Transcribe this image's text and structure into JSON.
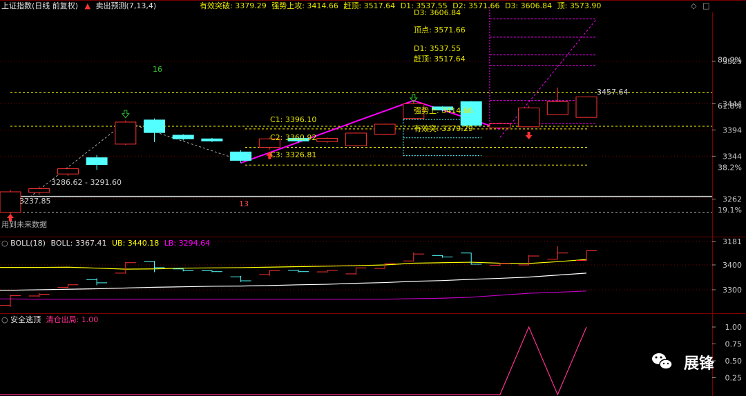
{
  "header": {
    "title": "上证指数(日线 前复权)",
    "indicator": "卖出预测(7,13,4)",
    "items": [
      {
        "label": "有效突破",
        "value": "3379.29"
      },
      {
        "label": "强势上攻",
        "value": "3414.66"
      },
      {
        "label": "赶顶",
        "value": "3517.64"
      },
      {
        "label": "D1",
        "value": "3537.55"
      },
      {
        "label": "D2",
        "value": "3571.66"
      },
      {
        "label": "D3",
        "value": "3606.84"
      },
      {
        "label": "顶",
        "value": "3573.90"
      }
    ],
    "top_right_icons": [
      "diamond-icon",
      "square-icon"
    ]
  },
  "colors": {
    "up": "#ff3232",
    "down": "#54ffff",
    "grid": "#7a0000",
    "yellow": "#ffff00",
    "magenta": "#ff00ff",
    "white": "#ffffff",
    "boll_lb": "#c000c0",
    "text": "#c8c8c8",
    "label_yellow": "#e6e600"
  },
  "chart_data": [
    {
      "type": "candlestick",
      "title": "上证指数(日线 前复权)",
      "y_ticks": [
        "3525",
        "3444",
        "3394",
        "3344",
        "3262",
        "3181"
      ],
      "pct_ticks": [
        "80.9%",
        "61.8%",
        "38.2%",
        "19.1%"
      ],
      "ylim": [
        3150,
        3610
      ],
      "candles": [
        {
          "o": 3237,
          "h": 3280,
          "l": 3231,
          "c": 3276
        },
        {
          "o": 3275,
          "h": 3286,
          "l": 3270,
          "c": 3282
        },
        {
          "o": 3310,
          "h": 3322,
          "l": 3306,
          "c": 3320
        },
        {
          "o": 3341,
          "h": 3346,
          "l": 3318,
          "c": 3328
        },
        {
          "o": 3367,
          "h": 3412,
          "l": 3365,
          "c": 3409
        },
        {
          "o": 3413,
          "h": 3416,
          "l": 3371,
          "c": 3389
        },
        {
          "o": 3384,
          "h": 3386,
          "l": 3374,
          "c": 3377
        },
        {
          "o": 3377,
          "h": 3379,
          "l": 3371,
          "c": 3373
        },
        {
          "o": 3352,
          "h": 3356,
          "l": 3331,
          "c": 3336
        },
        {
          "o": 3361,
          "h": 3379,
          "l": 3357,
          "c": 3377
        },
        {
          "o": 3378,
          "h": 3381,
          "l": 3370,
          "c": 3373
        },
        {
          "o": 3372,
          "h": 3380,
          "l": 3369,
          "c": 3378
        },
        {
          "o": 3364,
          "h": 3389,
          "l": 3361,
          "c": 3388
        },
        {
          "o": 3386,
          "h": 3406,
          "l": 3385,
          "c": 3405
        },
        {
          "o": 3416,
          "h": 3450,
          "l": 3414,
          "c": 3444
        },
        {
          "o": 3438,
          "h": 3439,
          "l": 3429,
          "c": 3432
        },
        {
          "o": 3448,
          "h": 3449,
          "l": 3401,
          "c": 3403
        },
        {
          "o": 3398,
          "h": 3408,
          "l": 3396,
          "c": 3406
        },
        {
          "o": 3400,
          "h": 3440,
          "l": 3399,
          "c": 3436
        },
        {
          "o": 3423,
          "h": 3475,
          "l": 3422,
          "c": 3448
        },
        {
          "o": 3418,
          "h": 3458,
          "l": 3417,
          "c": 3457
        }
      ],
      "h_levels": [
        {
          "value": 3465,
          "style": "yellow-dash"
        },
        {
          "value": 3401,
          "style": "yellow-dash"
        },
        {
          "value": 3267,
          "style": "white-solid"
        },
        {
          "value": 3237,
          "style": "white-dash"
        }
      ],
      "price_labels": [
        {
          "text": "3286.62 - 3291.60"
        },
        {
          "text": "3237.85"
        },
        {
          "text": "3457.64"
        }
      ],
      "counts": [
        "16",
        "13"
      ],
      "c_labels": [
        "C1: 3396.10",
        "C2: 3360.92",
        "C3: 3326.81"
      ],
      "strong_labels": [
        "强势上: 3414.66",
        "有效突: 3379.29"
      ],
      "top_labels": [
        "D3: 3606.84",
        "顶点: 3571.66",
        "D1: 3537.55",
        "赶顶: 3517.64"
      ],
      "footer_note": "用到未来数据"
    },
    {
      "type": "line",
      "title": "BOLL(18)",
      "legend": [
        {
          "name": "BOLL",
          "value": "3367.41"
        },
        {
          "name": "UB",
          "value": "3440.18"
        },
        {
          "name": "LB",
          "value": "3294.64"
        }
      ],
      "y_ticks": [
        "3400",
        "3300"
      ],
      "series": [
        {
          "name": "UB",
          "values": [
            3390,
            3390,
            3391,
            3387,
            3383,
            3384,
            3387,
            3388,
            3389,
            3391,
            3393,
            3395,
            3397,
            3400,
            3407,
            3409,
            3411,
            3407,
            3406,
            3413,
            3422
          ]
        },
        {
          "name": "BOLL",
          "values": [
            3298,
            3300,
            3302,
            3304,
            3307,
            3310,
            3312,
            3314,
            3315,
            3317,
            3320,
            3322,
            3326,
            3329,
            3334,
            3337,
            3342,
            3346,
            3351,
            3359,
            3367
          ]
        },
        {
          "name": "LB",
          "values": [
            3263,
            3262,
            3262,
            3262,
            3262,
            3262,
            3262,
            3262,
            3262,
            3262,
            3262,
            3262,
            3262,
            3262,
            3264,
            3266,
            3270,
            3278,
            3286,
            3290,
            3295
          ]
        }
      ]
    },
    {
      "type": "line",
      "title": "安全逃顶",
      "legend": [
        {
          "name": "清仓出局",
          "value": "1.00"
        }
      ],
      "y_ticks": [
        "1.00",
        "0.75",
        "0.50",
        "0.25"
      ],
      "ylim": [
        0,
        1.05
      ],
      "series": [
        {
          "name": "清仓出局",
          "values": [
            0,
            0,
            0,
            0,
            0,
            0,
            0,
            0,
            0,
            0,
            0,
            0,
            0,
            0,
            0,
            0,
            0,
            0,
            1,
            0,
            1
          ]
        }
      ]
    }
  ],
  "watermark": {
    "text": "展锋",
    "icon": "wechat-icon"
  }
}
